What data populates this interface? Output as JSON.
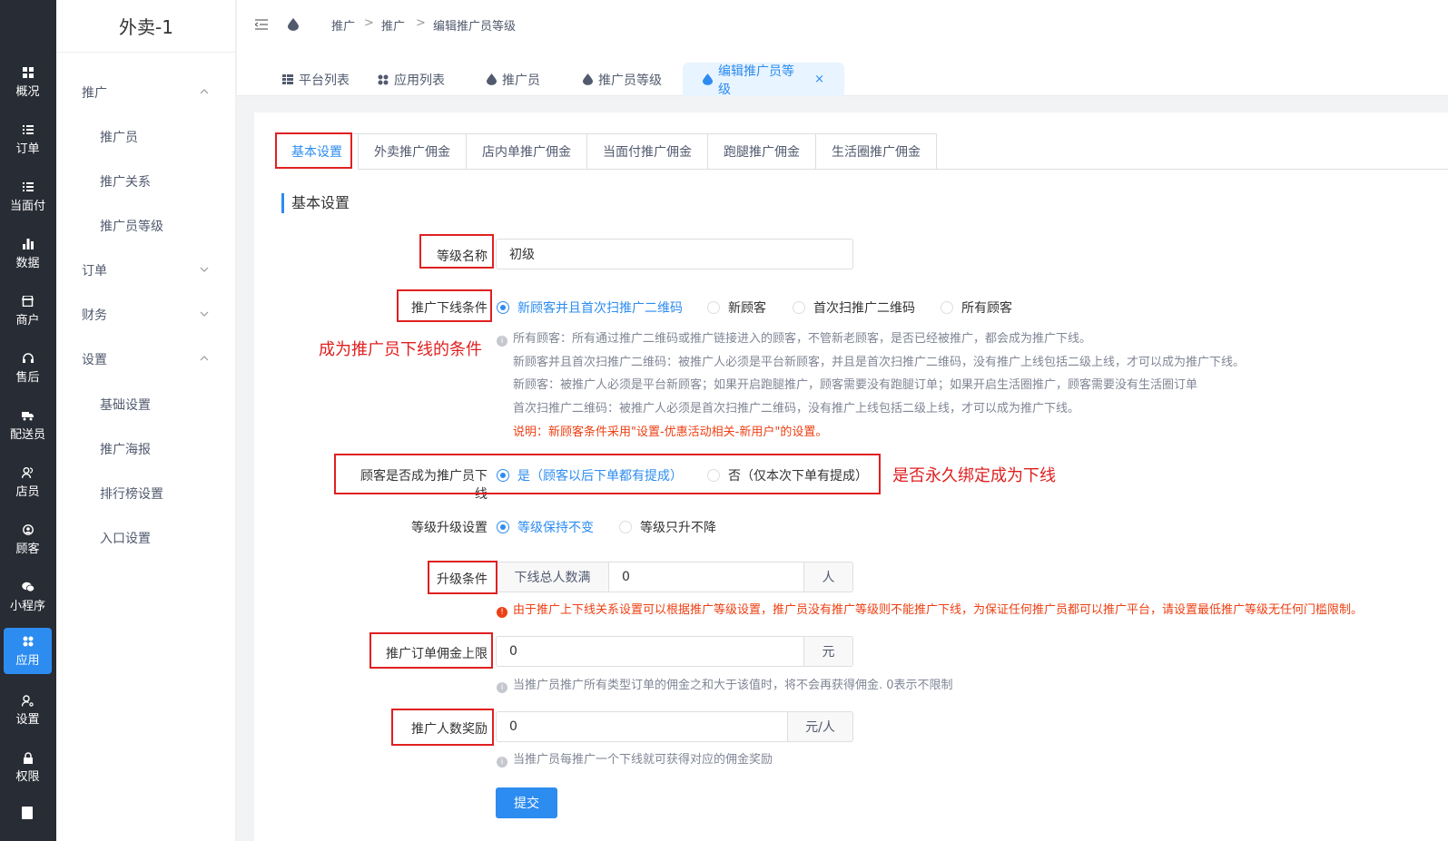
{
  "nav": {
    "items": [
      {
        "label": "概况",
        "icon": "dashboard-icon"
      },
      {
        "label": "订单",
        "icon": "list-icon"
      },
      {
        "label": "当面付",
        "icon": "list-icon"
      },
      {
        "label": "数据",
        "icon": "bar-chart-icon"
      },
      {
        "label": "商户",
        "icon": "store-icon"
      },
      {
        "label": "售后",
        "icon": "headset-icon"
      },
      {
        "label": "配送员",
        "icon": "truck-icon"
      },
      {
        "label": "店员",
        "icon": "staff-icon"
      },
      {
        "label": "顾客",
        "icon": "customer-icon"
      },
      {
        "label": "小程序",
        "icon": "wechat-icon"
      },
      {
        "label": "应用",
        "icon": "apps-icon"
      },
      {
        "label": "设置",
        "icon": "settings-icon"
      },
      {
        "label": "权限",
        "icon": "lock-icon"
      }
    ],
    "active_index": 10,
    "active_color": "#2d8cf0"
  },
  "sidebar": {
    "title": "外卖-1",
    "groups": {
      "promote": "推广",
      "promoter": "推广员",
      "relation": "推广关系",
      "level": "推广员等级",
      "order": "订单",
      "finance": "财务",
      "settings": "设置",
      "basic": "基础设置",
      "poster": "推广海报",
      "ranking": "排行榜设置",
      "entry": "入口设置"
    }
  },
  "breadcrumb": {
    "a": "推广",
    "b": "推广",
    "c": "编辑推广员等级",
    "sep": ">"
  },
  "page_tabs": {
    "platform": "平台列表",
    "apps": "应用列表",
    "promoter": "推广员",
    "level": "推广员等级",
    "edit": "编辑推广员等级",
    "close": "×"
  },
  "settings_tabs": {
    "basic": "基本设置",
    "takeout": "外卖推广佣金",
    "instore": "店内单推广佣金",
    "facepay": "当面付推广佣金",
    "errand": "跑腿推广佣金",
    "life": "生活圈推广佣金"
  },
  "section_title": "基本设置",
  "form": {
    "level_name_label": "等级名称",
    "level_name_value": "初级",
    "condition_label": "推广下线条件",
    "condition_options": {
      "o1": "新顾客并且首次扫推广二维码",
      "o2": "新顾客",
      "o3": "首次扫推广二维码",
      "o4": "所有顾客"
    },
    "condition_hints": {
      "h1": "所有顾客：所有通过推广二维码或推广链接进入的顾客，不管新老顾客，是否已经被推广，都会成为推广下线。",
      "h2": "新顾客并且首次扫推广二维码：被推广人必须是平台新顾客，并且是首次扫推广二维码，没有推广上线包括二级上线，才可以成为推广下线。",
      "h3": "新顾客：被推广人必须是平台新顾客；如果开启跑腿推广，顾客需要没有跑腿订单；如果开启生活圈推广，顾客需要没有生活圈订单",
      "h4": "首次扫推广二维码：被推广人必须是首次扫推广二维码，没有推广上线包括二级上线，才可以成为推广下线。",
      "note": "说明：新顾客条件采用\"设置-优惠活动相关-新用户\"的设置。"
    },
    "become_label": "顾客是否成为推广员下线",
    "become_yes": "是（顾客以后下单都有提成）",
    "become_no": "否（仅本次下单有提成）",
    "upgrade_label": "等级升级设置",
    "upgrade_keep": "等级保持不变",
    "upgrade_only_up": "等级只升不降",
    "upgrade_cond_label": "升级条件",
    "upgrade_cond_prefix": "下线总人数满",
    "upgrade_cond_value": "0",
    "upgrade_cond_unit": "人",
    "upgrade_warning": "由于推广上下线关系设置可以根据推广等级设置，推广员没有推广等级则不能推广下线，为保证任何推广员都可以推广平台，请设置最低推广等级无任何门槛限制。",
    "cap_label": "推广订单佣金上限",
    "cap_value": "0",
    "cap_unit": "元",
    "cap_hint": "当推广员推广所有类型订单的佣金之和大于该值时，将不会再获得佣金. 0表示不限制",
    "reward_label": "推广人数奖励",
    "reward_value": "0",
    "reward_unit": "元/人",
    "reward_hint": "当推广员每推广一个下线就可获得对应的佣金奖励",
    "submit": "提交"
  },
  "annotations": {
    "a1": "成为推广员下线的条件",
    "a2": "是否永久绑定成为下线",
    "color": "#e02020"
  }
}
